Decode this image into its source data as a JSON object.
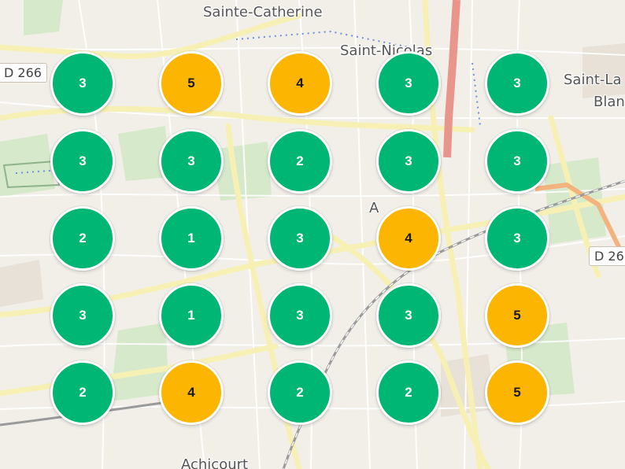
{
  "labels": {
    "sainte_catherine": "Sainte-Catherine",
    "saint_nicolas": "Saint-Nicolas",
    "saint_laurent": "Saint-La",
    "saint_laurent_line2": "Blan",
    "arras": "A",
    "achicourt": "Achicourt",
    "road_d266_left": "D 266",
    "road_d26_right": "D 26"
  },
  "colors": {
    "green": "#00b674",
    "amber": "#fcb500"
  },
  "grid": {
    "rows": [
      [
        {
          "value": "3",
          "color": "green"
        },
        {
          "value": "5",
          "color": "amber"
        },
        {
          "value": "4",
          "color": "amber"
        },
        {
          "value": "3",
          "color": "green"
        },
        {
          "value": "3",
          "color": "green"
        }
      ],
      [
        {
          "value": "3",
          "color": "green"
        },
        {
          "value": "3",
          "color": "green"
        },
        {
          "value": "2",
          "color": "green"
        },
        {
          "value": "3",
          "color": "green"
        },
        {
          "value": "3",
          "color": "green"
        }
      ],
      [
        {
          "value": "2",
          "color": "green"
        },
        {
          "value": "1",
          "color": "green"
        },
        {
          "value": "3",
          "color": "green"
        },
        {
          "value": "4",
          "color": "amber"
        },
        {
          "value": "3",
          "color": "green"
        }
      ],
      [
        {
          "value": "3",
          "color": "green"
        },
        {
          "value": "1",
          "color": "green"
        },
        {
          "value": "3",
          "color": "green"
        },
        {
          "value": "3",
          "color": "green"
        },
        {
          "value": "5",
          "color": "amber"
        }
      ],
      [
        {
          "value": "2",
          "color": "green"
        },
        {
          "value": "4",
          "color": "amber"
        },
        {
          "value": "2",
          "color": "green"
        },
        {
          "value": "2",
          "color": "green"
        },
        {
          "value": "5",
          "color": "amber"
        }
      ]
    ]
  }
}
